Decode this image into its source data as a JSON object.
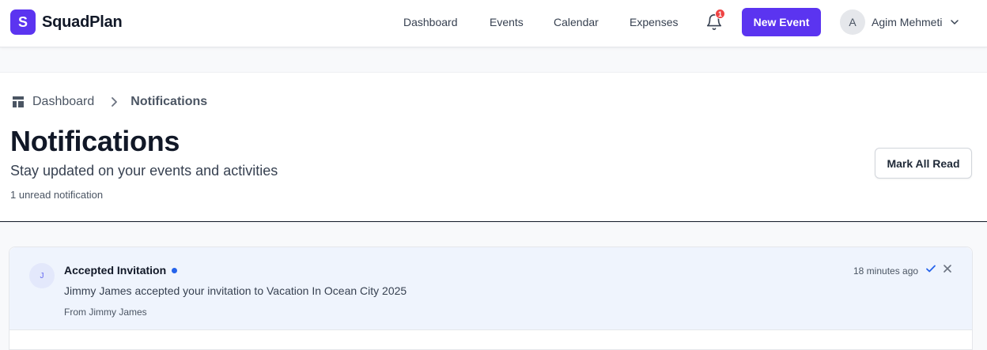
{
  "app": {
    "logo_letter": "S",
    "name": "SquadPlan"
  },
  "nav": {
    "dashboard": "Dashboard",
    "events": "Events",
    "calendar": "Calendar",
    "expenses": "Expenses"
  },
  "notifications_bell": {
    "icon": "bell-icon",
    "badge_count": "1"
  },
  "actions": {
    "new_event": "New Event",
    "mark_all_read": "Mark All Read"
  },
  "user": {
    "avatar_initial": "A",
    "name": "Agim Mehmeti"
  },
  "breadcrumb": {
    "home": "Dashboard",
    "current": "Notifications"
  },
  "page": {
    "title": "Notifications",
    "subtitle": "Stay updated on your events and activities",
    "unread_summary": "1 unread notification"
  },
  "notifications": [
    {
      "avatar_initial": "J",
      "title": "Accepted Invitation",
      "unread": true,
      "message": "Jimmy James accepted your invitation to Vacation In Ocean City 2025",
      "from": "From Jimmy James",
      "time": "18 minutes ago"
    }
  ],
  "colors": {
    "brand": "#5b34f0",
    "badge": "#ef4444",
    "unread_dot": "#2563eb",
    "unread_row_bg": "#eff4fd"
  }
}
